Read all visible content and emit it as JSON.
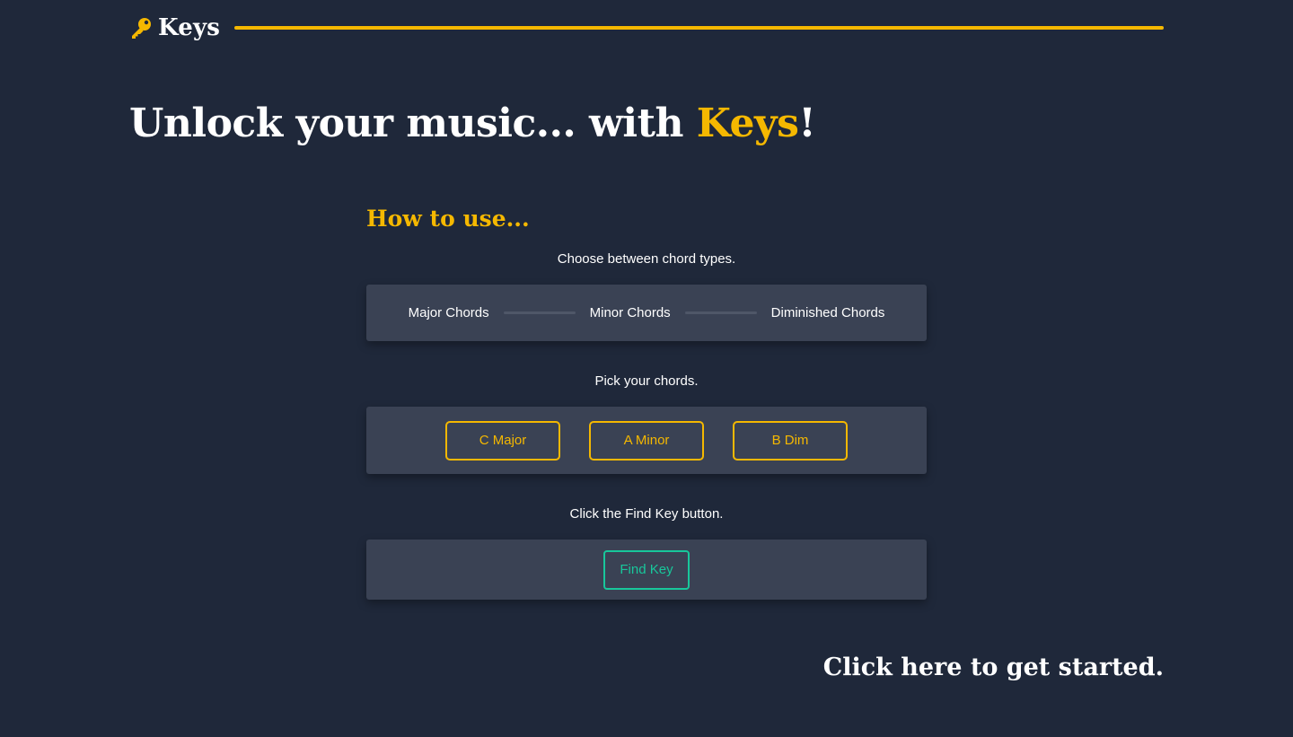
{
  "brand": {
    "name": "Keys",
    "icon": "key-icon"
  },
  "hero": {
    "title_prefix": "Unlock your music... with ",
    "title_accent": "Keys",
    "title_suffix": "!"
  },
  "howto": {
    "title": "How to use...",
    "step1": "Choose between chord types.",
    "chord_types": [
      "Major Chords",
      "Minor Chords",
      "Diminished Chords"
    ],
    "step2": "Pick your chords.",
    "chords": [
      "C Major",
      "A Minor",
      "B Dim"
    ],
    "step3": "Click the Find Key button.",
    "find_button": "Find Key"
  },
  "cta": "Click here to get started.",
  "colors": {
    "background": "#1f283a",
    "panel": "#3a4254",
    "accent": "#f5b800",
    "find": "#18c79b"
  }
}
